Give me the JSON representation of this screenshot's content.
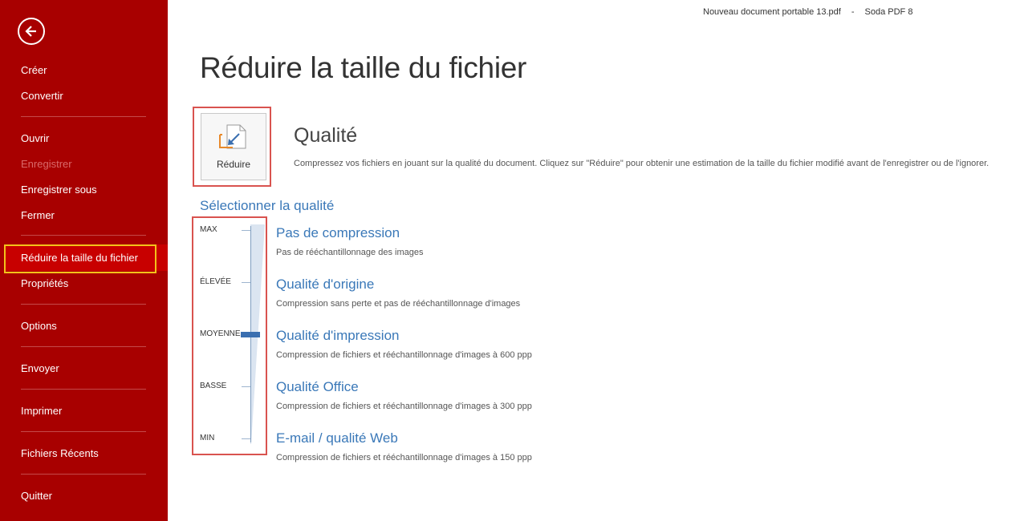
{
  "titlebar": {
    "document": "Nouveau document portable 13.pdf",
    "separator": "-",
    "app": "Soda PDF 8"
  },
  "sidebar": {
    "back_icon": "back-arrow-icon",
    "items": [
      {
        "label": "Créer"
      },
      {
        "label": "Convertir"
      },
      {
        "label": "Ouvrir"
      },
      {
        "label": "Enregistrer"
      },
      {
        "label": "Enregistrer sous"
      },
      {
        "label": "Fermer"
      },
      {
        "label": "Réduire la taille du fichier"
      },
      {
        "label": "Propriétés"
      },
      {
        "label": "Options"
      },
      {
        "label": "Envoyer"
      },
      {
        "label": "Imprimer"
      },
      {
        "label": "Fichiers Récents"
      },
      {
        "label": "Quitter"
      }
    ],
    "colors": {
      "background": "#a80000",
      "active": "#c80000",
      "highlight_outline": "#f3c21a"
    }
  },
  "main": {
    "title": "Réduire la taille du fichier",
    "reduce_button": {
      "label": "Réduire",
      "icon": "compress-file-icon"
    },
    "quality": {
      "heading": "Qualité",
      "description": "Compressez vos fichiers en jouant sur la qualité du document. Cliquez sur \"Réduire\" pour obtenir une estimation de la taille du fichier modifié avant de l'enregistrer ou de l'ignorer."
    },
    "select_heading": "Sélectionner la qualité",
    "slider": {
      "levels": [
        "MAX",
        "ÉLEVÉE",
        "MOYENNE",
        "BASSE",
        "MIN"
      ],
      "selected": "MOYENNE"
    },
    "options": [
      {
        "title": "Pas de compression",
        "desc": "Pas de rééchantillonnage des images"
      },
      {
        "title": "Qualité d'origine",
        "desc": "Compression sans perte et pas de rééchantillonnage d'images"
      },
      {
        "title": "Qualité d'impression",
        "desc": "Compression de fichiers et rééchantillonnage d'images à 600 ppp"
      },
      {
        "title": "Qualité Office",
        "desc": "Compression de fichiers et rééchantillonnage d'images à 300 ppp"
      },
      {
        "title": "E-mail / qualité Web",
        "desc": "Compression de fichiers et rééchantillonnage d'images à 150 ppp"
      }
    ],
    "colors": {
      "accent": "#3a78b8",
      "annotation": "#d9534f"
    }
  }
}
